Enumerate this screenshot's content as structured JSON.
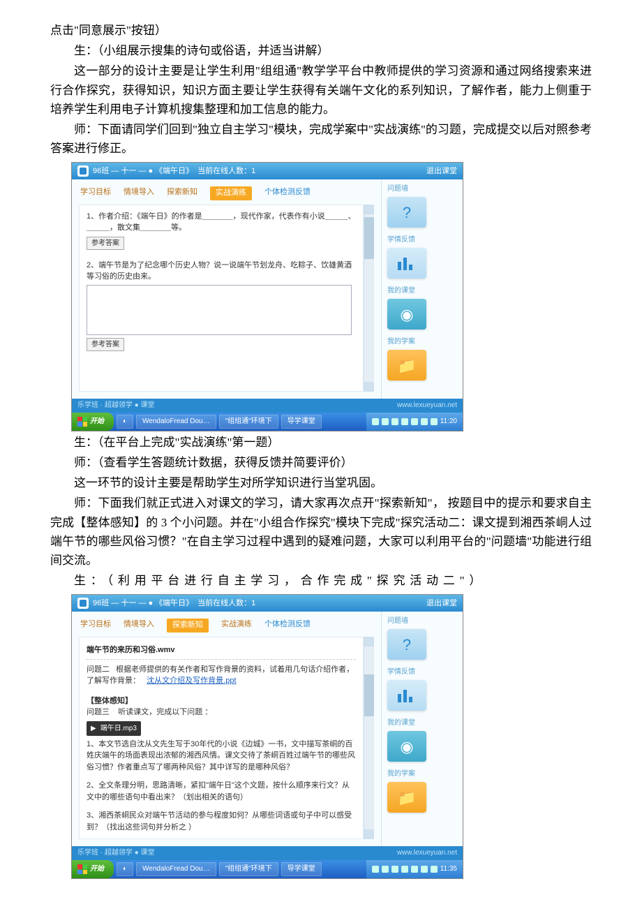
{
  "paragraphs": {
    "p1": "点击\"同意展示\"按钮）",
    "p2": "生：（小组展示搜集的诗句或俗语，并适当讲解）",
    "p3": "这一部分的设计主要是让学生利用\"组组通\"教学学平台中教师提供的学习资源和通过网络搜索来进行合作探究，获得知识，知识方面主要让学生获得有关端午文化的系列知识，了解作者，能力上侧重于培养学生利用电子计算机搜集整理和加工信息的能力。",
    "p4": "师：下面请同学们回到\"独立自主学习\"模块，完成学案中\"实战演练\"的习题，完成提交以后对照参考答案进行修正。",
    "p5": "生：（在平台上完成\"实战演练\"第一题）",
    "p6": "师：（查看学生答题统计数据，获得反馈并简要评价）",
    "p7": "这一环节的设计主要是帮助学生对所学知识进行当堂巩固。",
    "p8": "师：下面我们就正式进入对课文的学习，请大家再次点开\"探索新知\"，  按题目中的提示和要求自主完成【整体感知】的 3 个小问题。并在\"小组合作探究\"模块下完成\"探究活动二：课文提到湘西茶峒人过端午节的哪些风俗习惯？\"在自主学习过程中遇到的疑难问题，大家可以利用平台的\"问题墙\"功能进行组间交流。",
    "p9": "生：（利用平台进行自主学习，合作完成\"探究活动二\"）"
  },
  "screenshot_common": {
    "class_label": "96班 — 十一 — ● 《端午日》",
    "online": "当前在线人数：1",
    "exit": "退出课堂",
    "brand_left": "乐学班 · 超越领学 ● 课堂",
    "brand_url": "www.lexueyuan.net",
    "taskbar": {
      "start": "开始",
      "items": [
        "",
        "WendaloFread Dou…",
        "\"组组通\"环境下",
        "导学课堂"
      ],
      "time": "11:20"
    },
    "side": {
      "q_wall": "问题墙",
      "feedback": "学情反馈",
      "my_class": "我的课堂",
      "my_plan": "我的学案"
    },
    "tabs": {
      "t1": "学习目标",
      "t2": "情境导入",
      "t3": "探索新知",
      "t4": "实战演练",
      "t5": "个体检测反馈"
    },
    "ans_btn": "参考答案"
  },
  "screenshot1": {
    "q1": "1、作者介绍：《端午日》的作者是＿＿＿＿，现代作家，代表作有小说＿＿＿、＿＿＿，散文集＿＿＿＿等。",
    "q2": "2、端午节是为了纪念哪个历史人物？说一说端午节划龙舟、吃粽子、饮雄黄酒等习俗的历史由来。"
  },
  "screenshot2": {
    "wmv": "端午节的来历和习俗.wmv",
    "q2_label": "问题二",
    "q2_text": "根据老师提供的有关作者和写作背景的资料，试着用几句话介绍作者，了解写作背景：",
    "ppt_link": "沈从文介绍及写作背景.ppt",
    "section": "【整体感知】",
    "q3_label": "问题三",
    "q3_text": "听读课文，完成以下问题 ：",
    "audio": "端午日.mp3",
    "item1": "1、本文节选自沈从文先生写于30年代的小说《边城》一书，文中描写茶峒的百姓庆端午的场面表现出浓郁的湘西风情。课文交待了茶峒百姓过端午节的哪些风俗习惯？作者重点写了哪两种风俗？其中详写的是哪种风俗？",
    "item2": "2、全文条理分明，思路清晰，紧扣\"端午日\"这个文题，按什么顺序来行文？从文中的哪些语句中看出来？（划出相关的语句）",
    "item3": "3、湘西茶峒民众对端午节活动的参与程度如何？从哪些词语或句子中可以感受到？（找出这些词句并分析之 ）",
    "time": "11:35"
  }
}
